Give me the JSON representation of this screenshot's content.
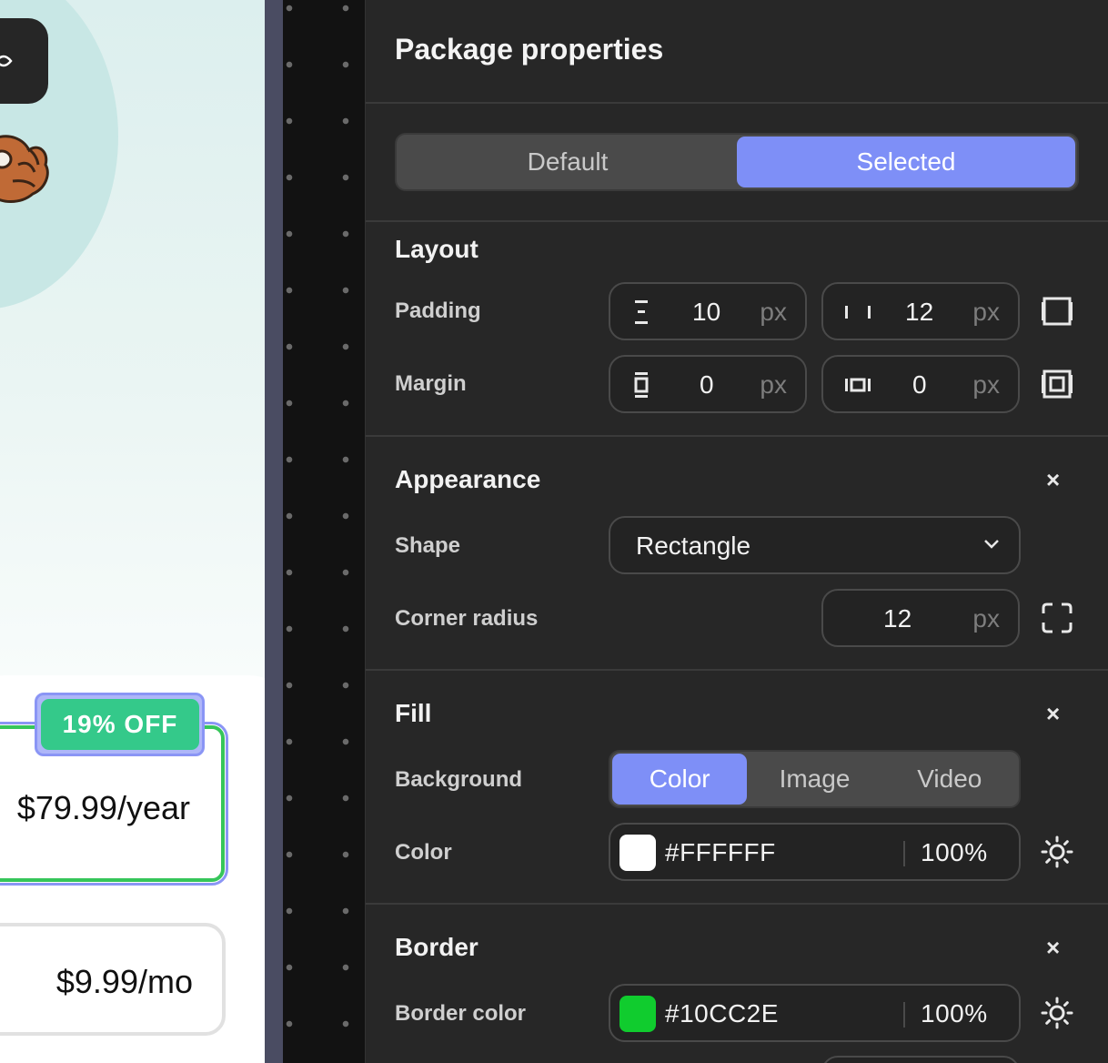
{
  "preview": {
    "yearly_package": {
      "price": "$79.99/year",
      "badge": "19% OFF",
      "border_color": "#36c65a"
    },
    "monthly_package": {
      "price": "$9.99/mo"
    }
  },
  "panel": {
    "title": "Package properties",
    "state_tabs": [
      {
        "label": "Default",
        "active": false
      },
      {
        "label": "Selected",
        "active": true
      }
    ],
    "layout": {
      "title": "Layout",
      "padding": {
        "label": "Padding",
        "vertical": "10",
        "horizontal": "12",
        "unit": "px"
      },
      "margin": {
        "label": "Margin",
        "vertical": "0",
        "horizontal": "0",
        "unit": "px"
      }
    },
    "appearance": {
      "title": "Appearance",
      "close": "×",
      "shape": {
        "label": "Shape",
        "value": "Rectangle"
      },
      "corner_radius": {
        "label": "Corner radius",
        "value": "12",
        "unit": "px"
      }
    },
    "fill": {
      "title": "Fill",
      "close": "×",
      "background": {
        "label": "Background",
        "options": [
          "Color",
          "Image",
          "Video"
        ],
        "selected": "Color"
      },
      "color": {
        "label": "Color",
        "hex": "#FFFFFF",
        "opacity": "100%",
        "swatch": "#FFFFFF"
      }
    },
    "border": {
      "title": "Border",
      "close": "×",
      "color": {
        "label": "Border color",
        "hex": "#10CC2E",
        "opacity": "100%",
        "swatch": "#10CC2E"
      }
    }
  },
  "colors": {
    "accent": "#7E8FF7",
    "panel_bg": "#272727",
    "badge_green": "#34C98A"
  },
  "icons": [
    "eye-icon",
    "padding-vertical-icon",
    "padding-horizontal-icon",
    "padding-individual-icon",
    "margin-vertical-icon",
    "margin-horizontal-icon",
    "margin-individual-icon",
    "chevron-down-icon",
    "close-icon",
    "corner-radius-icon",
    "theme-sun-icon"
  ]
}
